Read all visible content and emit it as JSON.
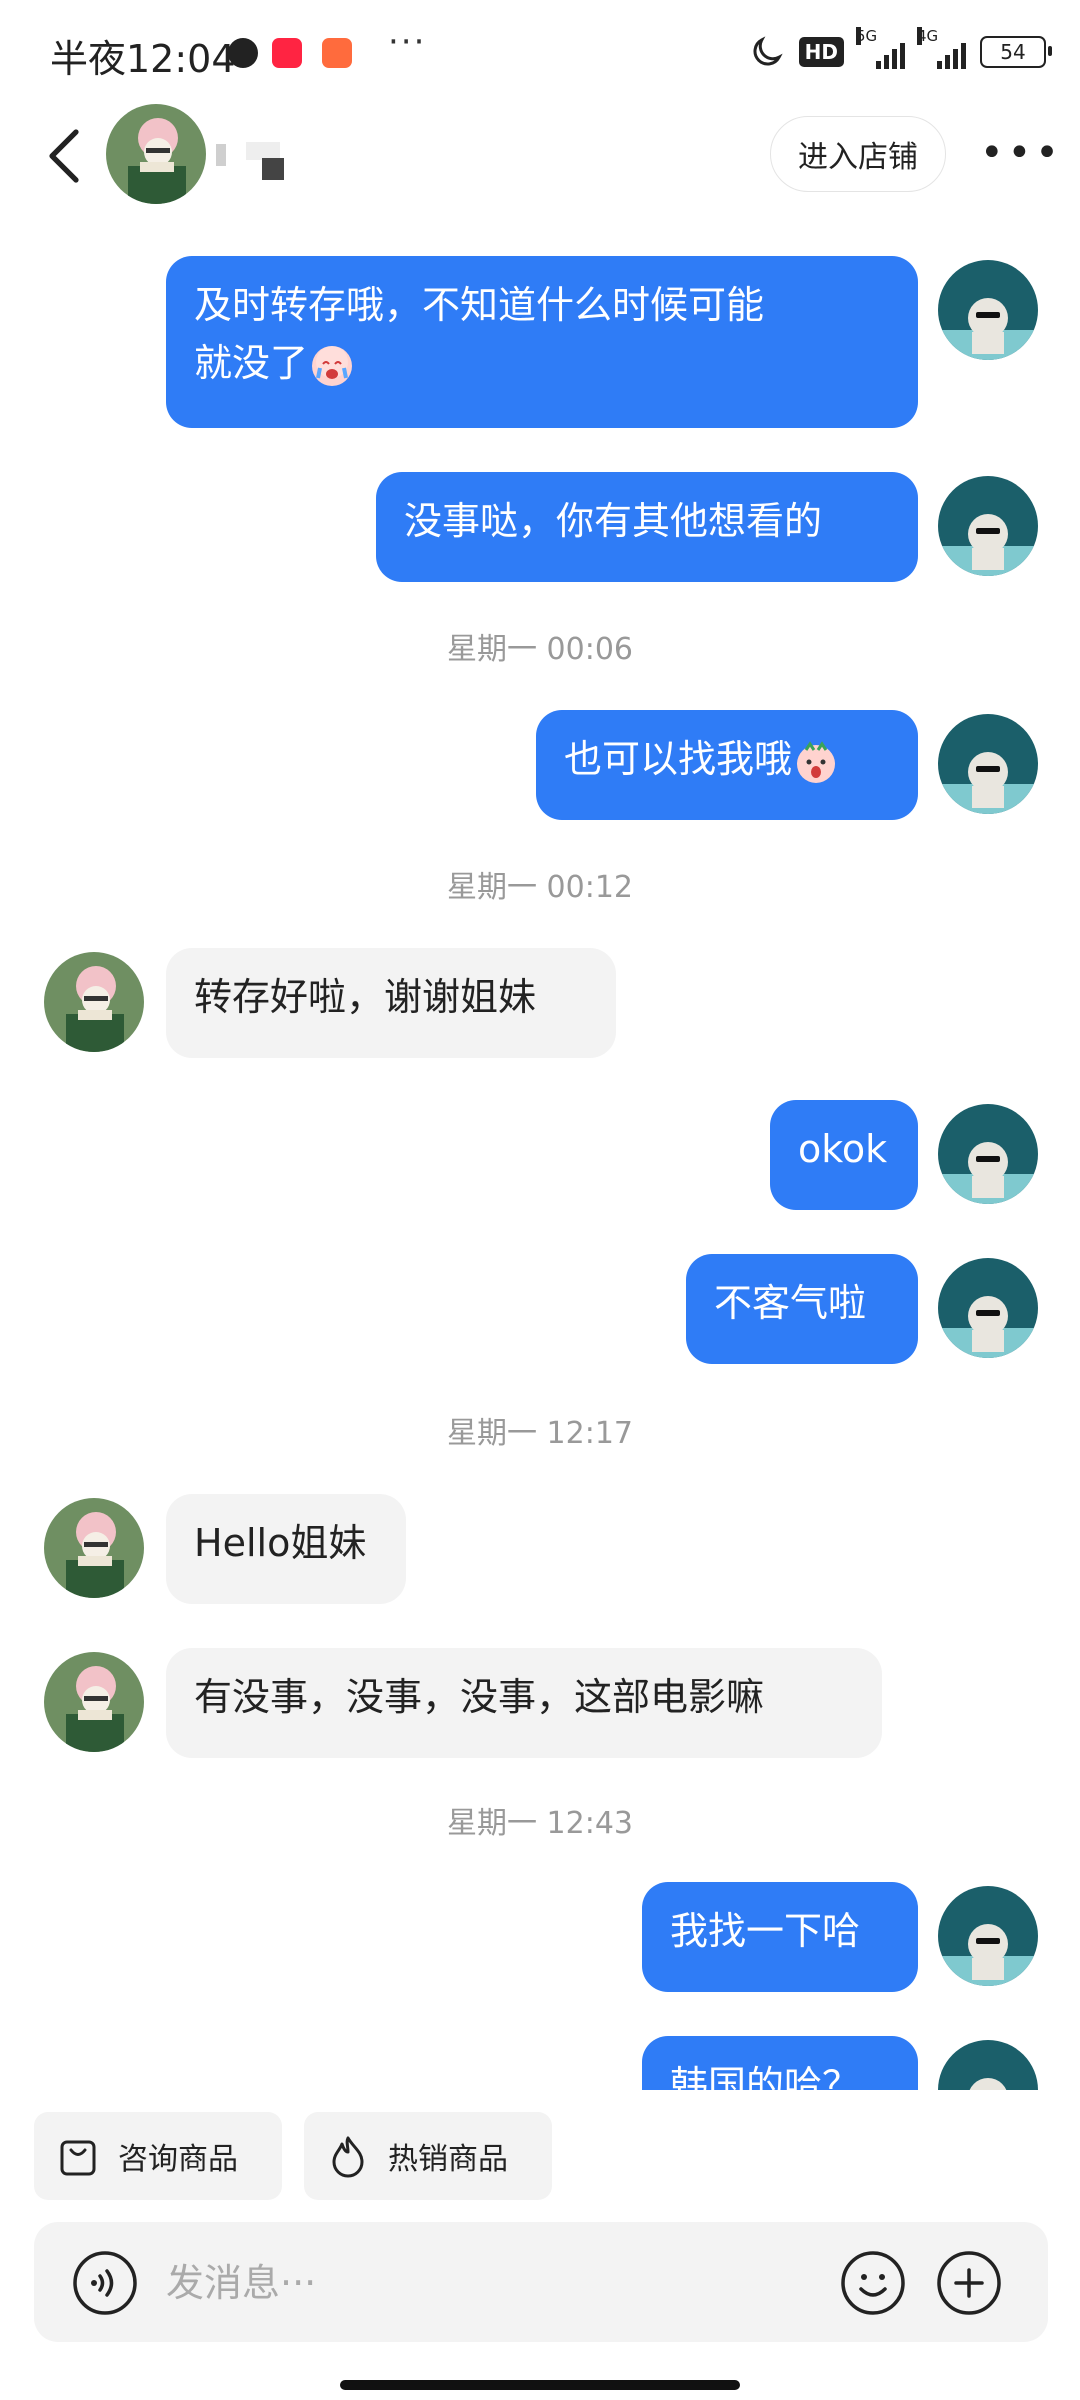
{
  "status_bar": {
    "time": "半夜12:04",
    "hd_label": "HD",
    "net_5g": "5G",
    "net_4g": "4G",
    "battery": "54",
    "more": "···"
  },
  "header": {
    "shop_button": "进入店铺",
    "more": "•••"
  },
  "messages": [
    {
      "id": "m1",
      "side": "out",
      "line1": "及时转存哦，不知道什么时候可能",
      "line2": "就没了",
      "emoji": "crying-face"
    },
    {
      "id": "m2",
      "side": "out",
      "text": "没事哒，你有其他想看的"
    },
    {
      "id": "t1",
      "type": "timestamp",
      "text": "星期一 00:06"
    },
    {
      "id": "m3",
      "side": "out",
      "text": "也可以找我哦",
      "emoji": "surprised-face"
    },
    {
      "id": "t2",
      "type": "timestamp",
      "text": "星期一 00:12"
    },
    {
      "id": "m4",
      "side": "in",
      "text": "转存好啦，谢谢姐妹"
    },
    {
      "id": "m5",
      "side": "out",
      "text": "okok"
    },
    {
      "id": "m6",
      "side": "out",
      "text": "不客气啦"
    },
    {
      "id": "t3",
      "type": "timestamp",
      "text": "星期一 12:17"
    },
    {
      "id": "m7",
      "side": "in",
      "text": "Hello姐妹"
    },
    {
      "id": "m8",
      "side": "in",
      "text": "有没事，没事，没事，这部电影嘛"
    },
    {
      "id": "t4",
      "type": "timestamp",
      "text": "星期一 12:43"
    },
    {
      "id": "m9",
      "side": "out",
      "text": "我找一下哈"
    },
    {
      "id": "m10",
      "side": "out",
      "text": "韩国的哈？"
    }
  ],
  "quick_actions": [
    {
      "label": "咨询商品",
      "icon": "shopping-bag-icon"
    },
    {
      "label": "热销商品",
      "icon": "flame-icon"
    }
  ],
  "input": {
    "placeholder": "发消息···"
  },
  "colors": {
    "outgoing_bubble": "#2f7cf6",
    "incoming_bubble": "#f3f3f3",
    "timestamp": "#999999"
  }
}
